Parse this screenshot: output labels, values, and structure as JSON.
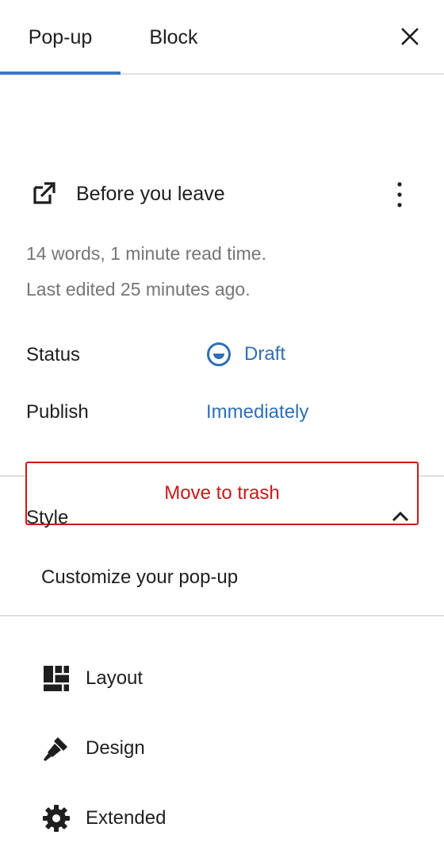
{
  "tabs": [
    {
      "label": "Pop-up",
      "active": true
    },
    {
      "label": "Block",
      "active": false
    }
  ],
  "close_icon": "close-icon",
  "document": {
    "icon": "external-popup-icon",
    "title": "Before you leave",
    "more_icon": "more-vertical-icon",
    "word_info": "14 words, 1 minute read time.",
    "last_edited": "Last edited 25 minutes ago.",
    "status_label": "Status",
    "status_value": "Draft",
    "status_icon": "draft-status-icon",
    "publish_label": "Publish",
    "publish_value": "Immediately",
    "trash_label": "Move to trash"
  },
  "style": {
    "title": "Style",
    "expanded": true,
    "toggle_icon": "chevron-up-icon",
    "description": "Customize your pop-up"
  },
  "menu": [
    {
      "label": "Layout",
      "icon": "layout-icon"
    },
    {
      "label": "Design",
      "icon": "brush-icon"
    },
    {
      "label": "Extended",
      "icon": "gear-icon"
    }
  ],
  "colors": {
    "accent": "#3a76c4",
    "link": "#2f6fb5",
    "danger": "#cc1818",
    "muted": "#757575",
    "text": "#1e1e1e",
    "divider": "#e0e0e0"
  }
}
